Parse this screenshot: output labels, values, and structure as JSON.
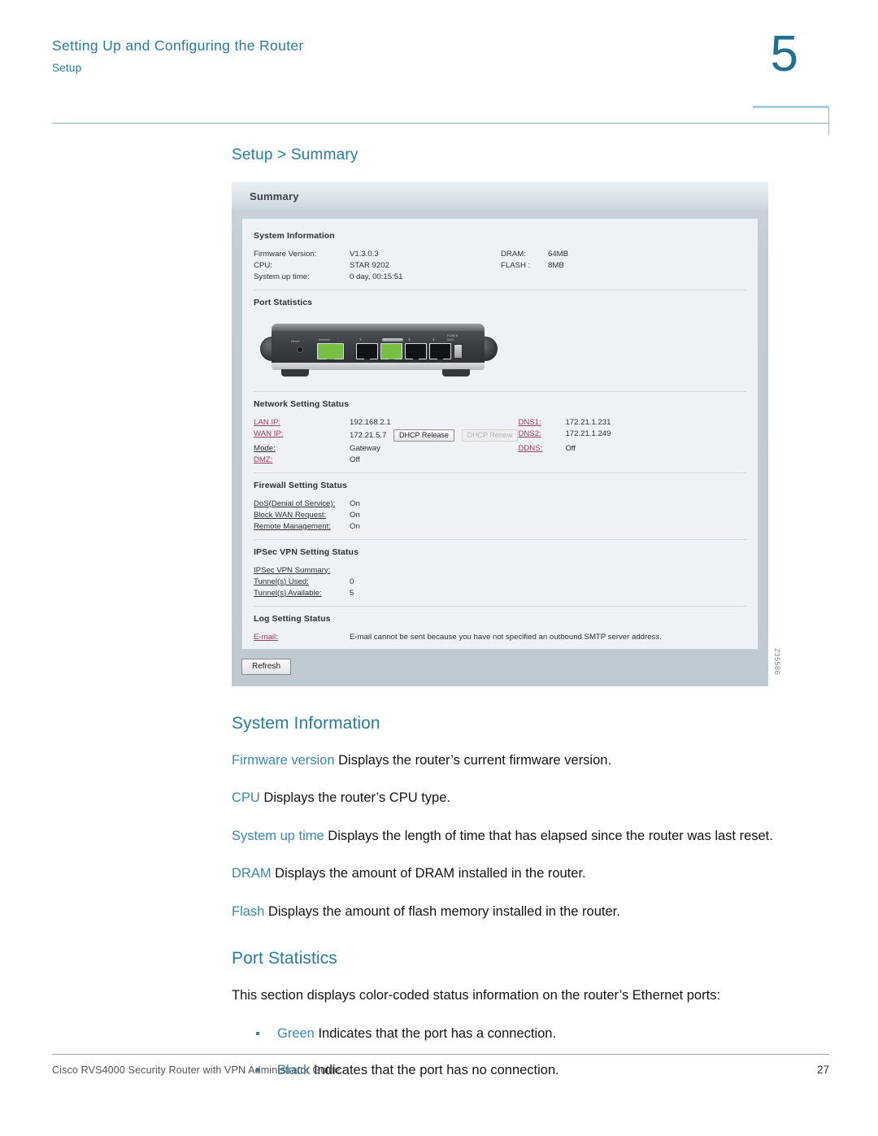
{
  "header": {
    "chapter_title": "Setting Up and Configuring the Router",
    "section_title": "Setup",
    "chapter_number": "5"
  },
  "content": {
    "breadcrumb_heading": "Setup > Summary",
    "system_information": {
      "heading": "System Information",
      "entries": [
        {
          "term": "Firmware version",
          "desc": " Displays the router’s current firmware version."
        },
        {
          "term": "CPU",
          "desc": " Displays the router’s CPU type."
        },
        {
          "term": "System up time",
          "desc": " Displays the length of time that has elapsed since the router was last reset."
        },
        {
          "term": "DRAM",
          "desc": " Displays the amount of DRAM installed in the router."
        },
        {
          "term": "Flash",
          "desc": " Displays the amount of flash memory installed in the router."
        }
      ]
    },
    "port_statistics": {
      "heading": "Port Statistics",
      "intro": "This section displays color-coded status information on the router’s Ethernet ports:",
      "bullets": [
        {
          "term": "Green",
          "desc": " Indicates that the port has a connection."
        },
        {
          "term": "Black",
          "desc": " Indicates that the port has no connection."
        }
      ]
    }
  },
  "figure": {
    "window_title": "Summary",
    "figure_id": "235586",
    "system_information": {
      "section_label": "System Information",
      "rows": [
        {
          "label": "Firmware Version:",
          "value": "V1.3.0.3",
          "label2": "DRAM:",
          "value2": "64MB"
        },
        {
          "label": "CPU:",
          "value": "STAR 9202",
          "label2": "FLASH :",
          "value2": "8MB"
        },
        {
          "label": "System up time:",
          "value": "0 day, 00:15:51",
          "label2": "",
          "value2": ""
        }
      ]
    },
    "port_statistics": {
      "section_label": "Port Statistics",
      "device": {
        "reset_label": "Reset",
        "internet_label": "Internet",
        "port_labels": [
          "1",
          "2",
          "3",
          "4"
        ],
        "port_states": [
          "black",
          "green",
          "black",
          "black"
        ],
        "internet_state": "green",
        "led_labels": "POWER\nDIAG"
      }
    },
    "network_setting_status": {
      "section_label": "Network Setting Status",
      "rows": [
        {
          "label": "LAN IP:",
          "value": "192.168.2.1",
          "label2": "DNS1:",
          "value2": "172.21.1.231"
        },
        {
          "label": "WAN IP:",
          "value": "172.21.5.7",
          "label2": "DNS2:",
          "value2": "172.21.1.249"
        },
        {
          "label": "Mode:",
          "value": "Gateway",
          "label2": "DDNS:",
          "value2": "Off"
        },
        {
          "label": "DMZ:",
          "value": "Off",
          "label2": "",
          "value2": ""
        }
      ],
      "dhcp_release_button": "DHCP Release",
      "dhcp_renew_button": "DHCP Renew"
    },
    "firewall_setting_status": {
      "section_label": "Firewall Setting Status",
      "rows": [
        {
          "label": "DoS(Denial of Service):",
          "value": "On"
        },
        {
          "label": "Block WAN Request:",
          "value": "On"
        },
        {
          "label": "Remote Management:",
          "value": "On"
        }
      ]
    },
    "ipsec_vpn_setting_status": {
      "section_label": "IPSec VPN Setting Status",
      "summary_link": "IPSec VPN Summary:",
      "rows": [
        {
          "label": "Tunnel(s) Used:",
          "value": "0"
        },
        {
          "label": "Tunnel(s) Available:",
          "value": "5"
        }
      ]
    },
    "log_setting_status": {
      "section_label": "Log Setting Status",
      "email_label": "E-mail:",
      "email_message": "E-mail cannot be sent because you have not specified an outbound SMTP server address."
    },
    "refresh_button": "Refresh"
  },
  "footer": {
    "text": "Cisco RVS4000 Security Router with VPN Administrator Guide",
    "page_number": "27"
  },
  "colors": {
    "accent_teal": "#2a7b9b",
    "term_blue": "#3a87ab",
    "link_magenta": "#9c3a62",
    "port_green": "#77c043"
  }
}
